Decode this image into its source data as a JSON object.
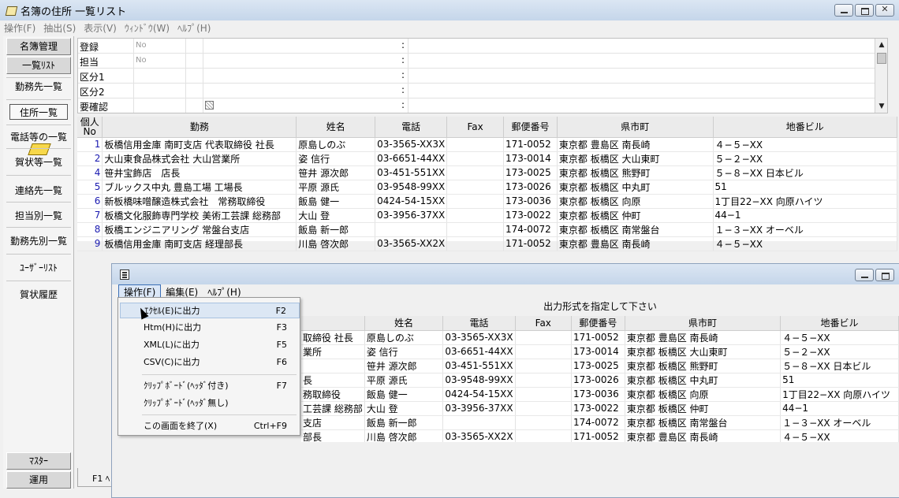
{
  "window": {
    "title": "名簿の住所 一覧リスト"
  },
  "menu": [
    "操作(F)",
    "抽出(S)",
    "表示(V)",
    "ｳｨﾝﾄﾞｳ(W)",
    "ﾍﾙﾌﾟ(H)"
  ],
  "sidebar": {
    "header_buttons": [
      "名簿管理",
      "一覧ﾘｽﾄ"
    ],
    "links": [
      "勤務先一覧",
      "住所一覧",
      "電話等の一覧",
      "賀状等一覧",
      "連絡先一覧",
      "担当別一覧",
      "勤務先別一覧",
      "ﾕｰｻﾞｰﾘｽﾄ",
      "賀状履歴"
    ],
    "bottom_buttons": [
      "ﾏｽﾀｰ",
      "運用"
    ]
  },
  "filters": [
    {
      "label": "登録",
      "value": "No"
    },
    {
      "label": "担当",
      "value": "No"
    },
    {
      "label": "区分1",
      "value": ""
    },
    {
      "label": "区分2",
      "value": ""
    },
    {
      "label": "要確認",
      "value": ""
    }
  ],
  "filter_colon": ":",
  "table": {
    "header_no": [
      "個人",
      "No"
    ],
    "columns": [
      "勤務",
      "姓名",
      "電話",
      "Fax",
      "郵便番号",
      "県市町",
      "地番ビル"
    ],
    "rows": [
      [
        "1",
        "板橋信用金庫 南町支店 代表取締役 社長",
        "原島しのぶ",
        "03-3565-XX3X",
        "",
        "171-0052",
        "東京都 豊島区 南長崎",
        "４−５−XX"
      ],
      [
        "2",
        "大山東食品株式会社 大山営業所",
        "姿 信行",
        "03-6651-44XX",
        "",
        "173-0014",
        "東京都 板橋区 大山東町",
        "５−２−XX"
      ],
      [
        "4",
        "笹井宝飾店　店長",
        "笹井 源次郎",
        "03-451-551XX",
        "",
        "173-0025",
        "東京都 板橋区 熊野町",
        "５−８−XX 日本ビル"
      ],
      [
        "5",
        "ブルックス中丸 豊島工場 工場長",
        "平原 源氏",
        "03-9548-99XX",
        "",
        "173-0026",
        "東京都 板橋区 中丸町",
        "51"
      ],
      [
        "6",
        "新板橋味噌醸造株式会社　常務取締役",
        "飯島 健一",
        "0424-54-15XX",
        "",
        "173-0036",
        "東京都 板橋区 向原",
        "1丁目22−XX 向原ハイツ"
      ],
      [
        "7",
        "板橋文化服飾専門学校 美術工芸課 総務部",
        "大山 登",
        "03-3956-37XX",
        "",
        "173-0022",
        "東京都 板橋区 仲町",
        "44−1"
      ],
      [
        "8",
        "板橋エンジニアリング 常盤台支店",
        "飯島 新一郎",
        "",
        "",
        "174-0072",
        "東京都 板橋区 南常盤台",
        "１−３−XX オーベル"
      ],
      [
        "9",
        "板橋信用金庫 南町支店 経理部長",
        "川島 啓次郎",
        "03-3565-XX2X",
        "",
        "171-0052",
        "東京都 豊島区 南長崎",
        "４−５−XX"
      ]
    ],
    "child_work_fragments": [
      "取締役 社長",
      "業所",
      "",
      "長",
      "務取締役",
      "工芸課 総務部",
      "支店",
      "部長"
    ]
  },
  "tab": {
    "label": "F1 ﾍ"
  },
  "child": {
    "menu": [
      "操作(F)",
      "編集(E)",
      "ﾍﾙﾌﾟ(H)"
    ],
    "prompt": "出力形式を指定して下さい",
    "dropdown": [
      {
        "label": "ｴｸｾﾙ(E)に出力",
        "key": "F2"
      },
      {
        "label": "Htm(H)に出力",
        "key": "F3"
      },
      {
        "label": "XML(L)に出力",
        "key": "F5"
      },
      {
        "label": "CSV(C)に出力",
        "key": "F6"
      },
      {
        "label": "ｸﾘｯﾌﾟﾎﾞｰﾄﾞ(ﾍｯﾀﾞ付き)",
        "key": "F7"
      },
      {
        "label": "ｸﾘｯﾌﾟﾎﾞｰﾄﾞ(ﾍｯﾀﾞ無し)",
        "key": ""
      },
      {
        "label": "この画面を終了(X)",
        "key": "Ctrl+F9"
      }
    ]
  }
}
